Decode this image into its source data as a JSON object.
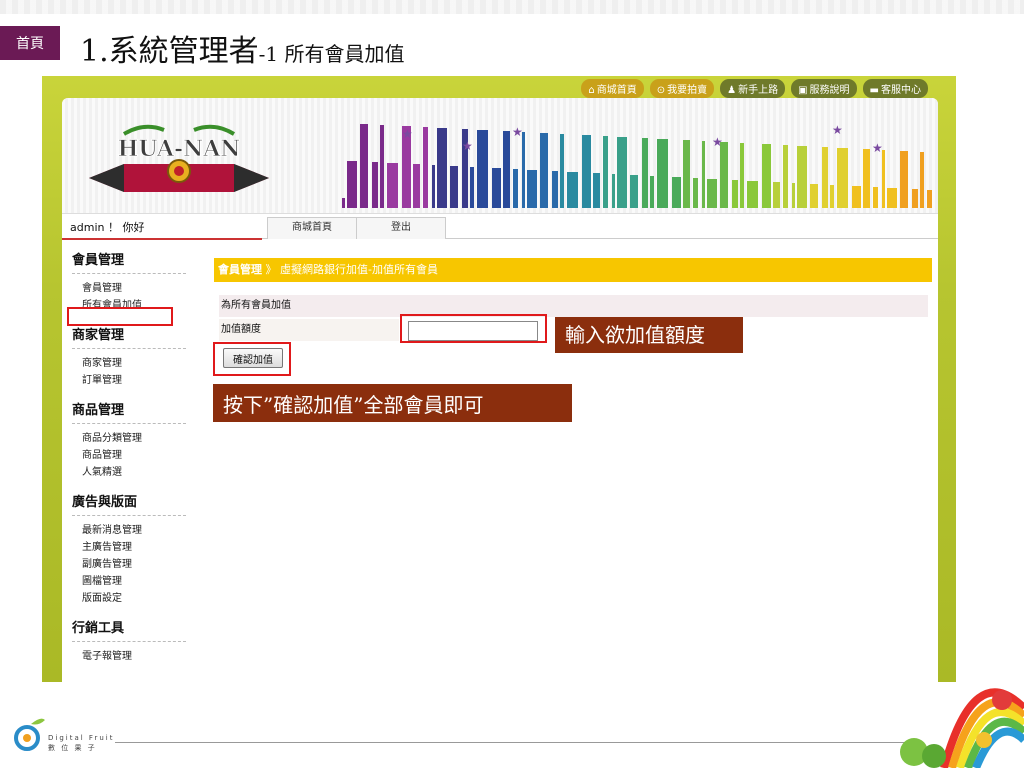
{
  "slide": {
    "home_badge": "首頁",
    "title_main": "1.系統管理者",
    "title_sub": "-1 所有會員加值"
  },
  "toplinks": [
    {
      "label": "商城首頁",
      "icon": "home-icon"
    },
    {
      "label": "我要拍賣",
      "icon": "auction-icon"
    },
    {
      "label": "新手上路",
      "icon": "user-icon"
    },
    {
      "label": "服務說明",
      "icon": "info-icon"
    },
    {
      "label": "客服中心",
      "icon": "chat-icon"
    }
  ],
  "logo_text": "HUA-NAN",
  "nav": {
    "greeting": "admin ！ 你好",
    "tabs": [
      "商城首頁",
      "登出"
    ]
  },
  "sidebar": [
    {
      "title": "會員管理",
      "items": [
        "會員管理",
        "所有會員加值"
      ]
    },
    {
      "title": "商家管理",
      "items": [
        "商家管理",
        "訂單管理"
      ]
    },
    {
      "title": "商品管理",
      "items": [
        "商品分類管理",
        "商品管理",
        "人氣精選"
      ]
    },
    {
      "title": "廣告與版面",
      "items": [
        "最新消息管理",
        "主廣告管理",
        "副廣告管理",
        "圖檔管理",
        "版面設定"
      ]
    },
    {
      "title": "行銷工具",
      "items": [
        "電子報管理"
      ]
    }
  ],
  "breadcrumb": {
    "section": "會員管理",
    "separator": "》",
    "path": "虛擬網路銀行加值-加值所有會員"
  },
  "form": {
    "header": "為所有會員加值",
    "amount_label": "加值額度",
    "amount_value": "",
    "confirm_label": "確認加值"
  },
  "callouts": {
    "input_hint": "輸入欲加值額度",
    "button_hint": "按下”確認加值”全部會員即可"
  },
  "footer": {
    "brand_en": "Digital Fruit",
    "brand_zh": "數 位 果 子"
  }
}
